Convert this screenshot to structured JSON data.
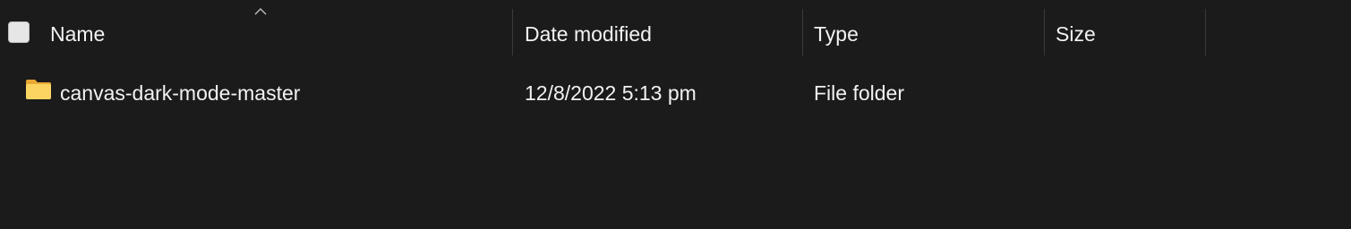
{
  "header": {
    "sort_icon": "chevron-up-icon",
    "checkbox_checked": false,
    "columns": {
      "name": "Name",
      "date_modified": "Date modified",
      "type": "Type",
      "size": "Size"
    }
  },
  "rows": [
    {
      "icon": "folder-icon",
      "name": "canvas-dark-mode-master",
      "date_modified": "12/8/2022 5:13 pm",
      "type": "File folder",
      "size": ""
    }
  ],
  "colors": {
    "background": "#1b1b1b",
    "text": "#f2f2f2",
    "folder": "#f8c24a"
  }
}
